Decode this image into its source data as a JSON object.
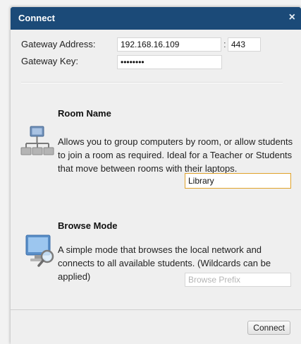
{
  "dialog": {
    "title": "Connect",
    "close_glyph": "×"
  },
  "gateway": {
    "address_label": "Gateway Address:",
    "address_value": "192.168.16.109",
    "colon": ":",
    "port_value": "443",
    "key_label": "Gateway Key:",
    "key_value": "secretkk"
  },
  "room": {
    "heading": "Room Name",
    "description": "Allows you to group computers by room, or allow students to join a room as required. Ideal for a Teacher or Students that move between rooms with their laptops.",
    "value": "Library",
    "icon": "network-hierarchy-icon"
  },
  "browse": {
    "heading": "Browse Mode",
    "description": "A simple mode that browses the local network and connects to all available students. (Wildcards can be applied)",
    "placeholder": "Browse Prefix",
    "icon": "monitor-search-icon"
  },
  "footer": {
    "connect_label": "Connect"
  },
  "colors": {
    "titlebar": "#1b4a78",
    "focus_border": "#e0a22a"
  }
}
